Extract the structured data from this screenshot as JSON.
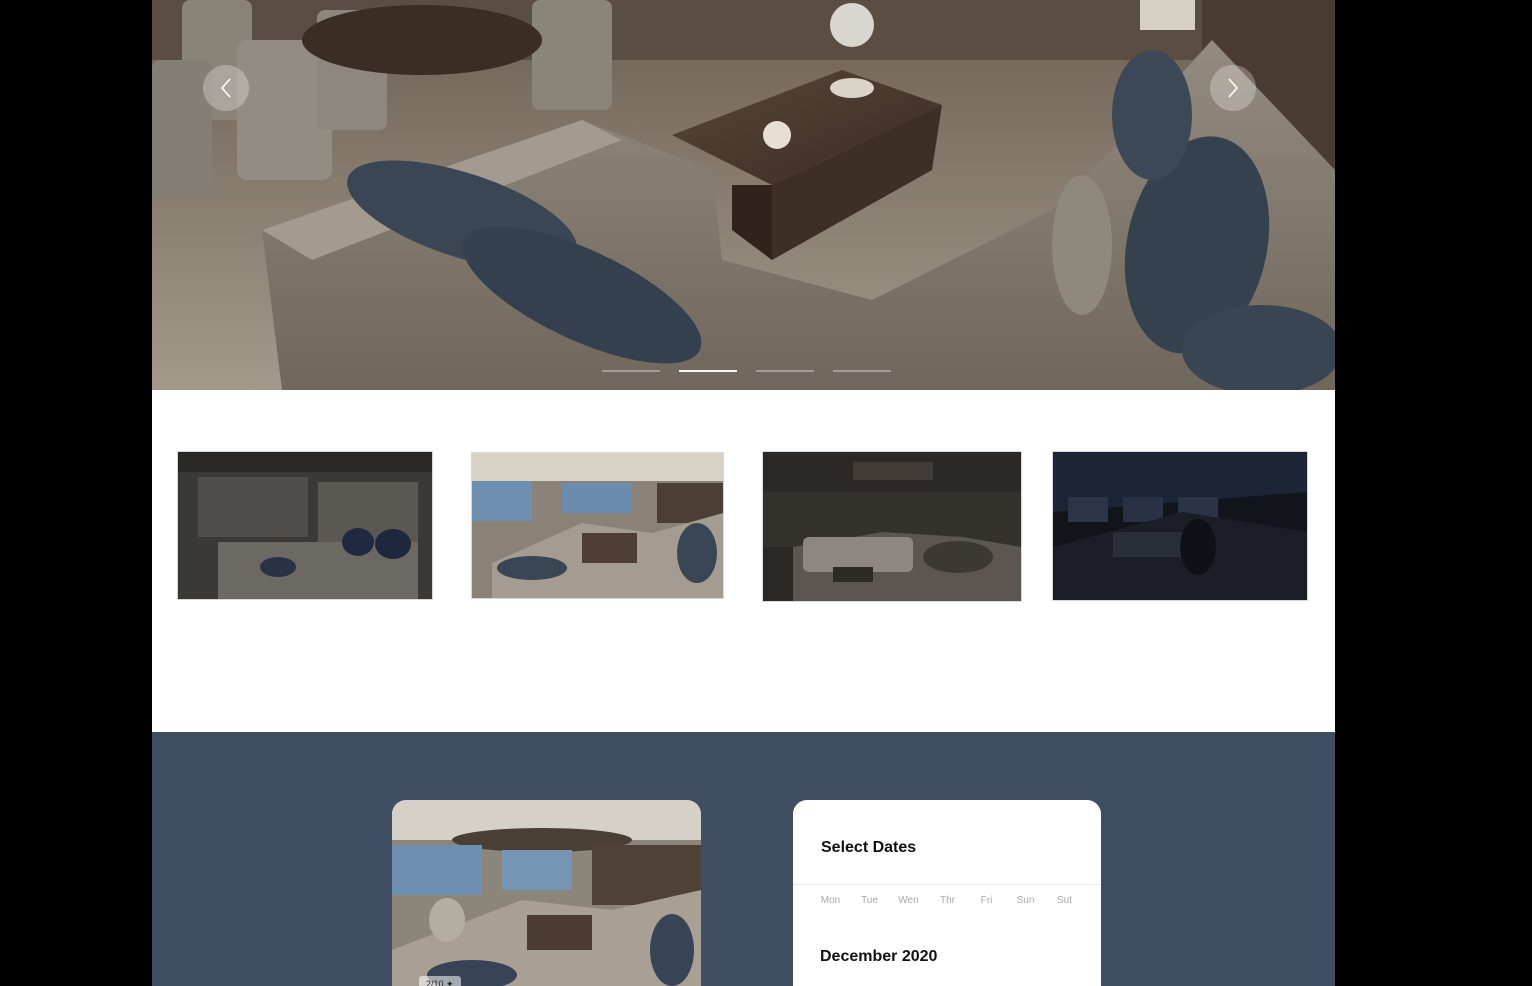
{
  "hero": {
    "slides": [
      "slide-1",
      "slide-2",
      "slide-3",
      "slide-4"
    ],
    "active_slide": 2,
    "prev_icon": "chevron-left-icon",
    "next_icon": "chevron-right-icon"
  },
  "gallery": {
    "thumbnails": [
      "bedroom",
      "salon",
      "lounge",
      "bridge"
    ]
  },
  "booking": {
    "preview_counter": "2/10 ✦",
    "calendar": {
      "title": "Select Dates",
      "weekdays": [
        "Mon",
        "Tue",
        "Wen",
        "Thr",
        "Fri",
        "Sun",
        "Sut"
      ],
      "month": "December 2020"
    }
  },
  "colors": {
    "page_background": "#000000",
    "booking_background": "#3f4e63",
    "card_background": "#ffffff"
  }
}
